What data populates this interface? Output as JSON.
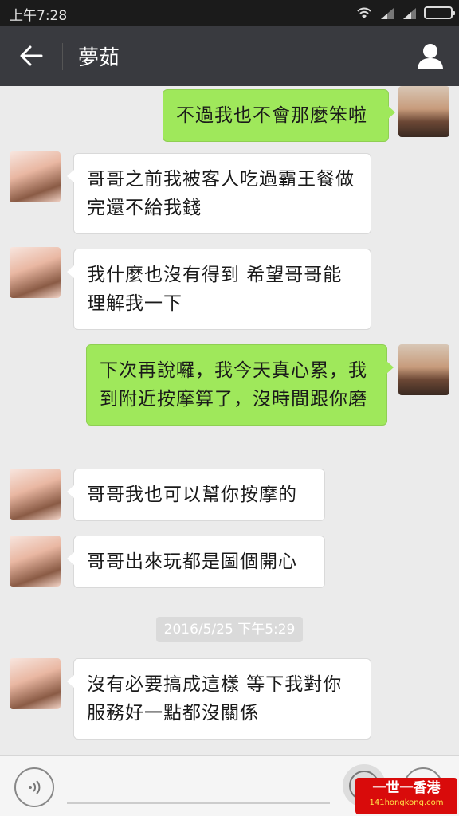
{
  "status_bar": {
    "time": "上午7:28"
  },
  "header": {
    "title": "夢茹"
  },
  "messages": [
    {
      "side": "right",
      "text": "不過我也不會那麼笨啦"
    },
    {
      "side": "left",
      "text": "哥哥之前我被客人吃過霸王餐做完還不給我錢"
    },
    {
      "side": "left",
      "text": "我什麼也沒有得到 希望哥哥能理解我一下"
    },
    {
      "side": "right",
      "text": "下次再說囉，我今天真心累，我到附近按摩算了，沒時間跟你磨"
    },
    {
      "side": "left",
      "text": "哥哥我也可以幫你按摩的"
    },
    {
      "side": "left",
      "text": "哥哥出來玩都是圖個開心"
    },
    {
      "side": "left",
      "text": "沒有必要搞成這樣  等下我對你服務好一點都沒關係"
    }
  ],
  "timestamp": "2016/5/25 下午5:29",
  "icons": [
    "back-arrow-icon",
    "profile-icon",
    "voice-icon",
    "emoji-icon",
    "plus-icon",
    "wifi-icon",
    "signal-icon",
    "battery-icon"
  ],
  "watermark": {
    "main": "一世一香港",
    "sub": "141hongkong.com"
  },
  "colors": {
    "header": "#393a3f",
    "bubble_right": "#9fe85b",
    "chat_bg": "#ebebeb"
  }
}
